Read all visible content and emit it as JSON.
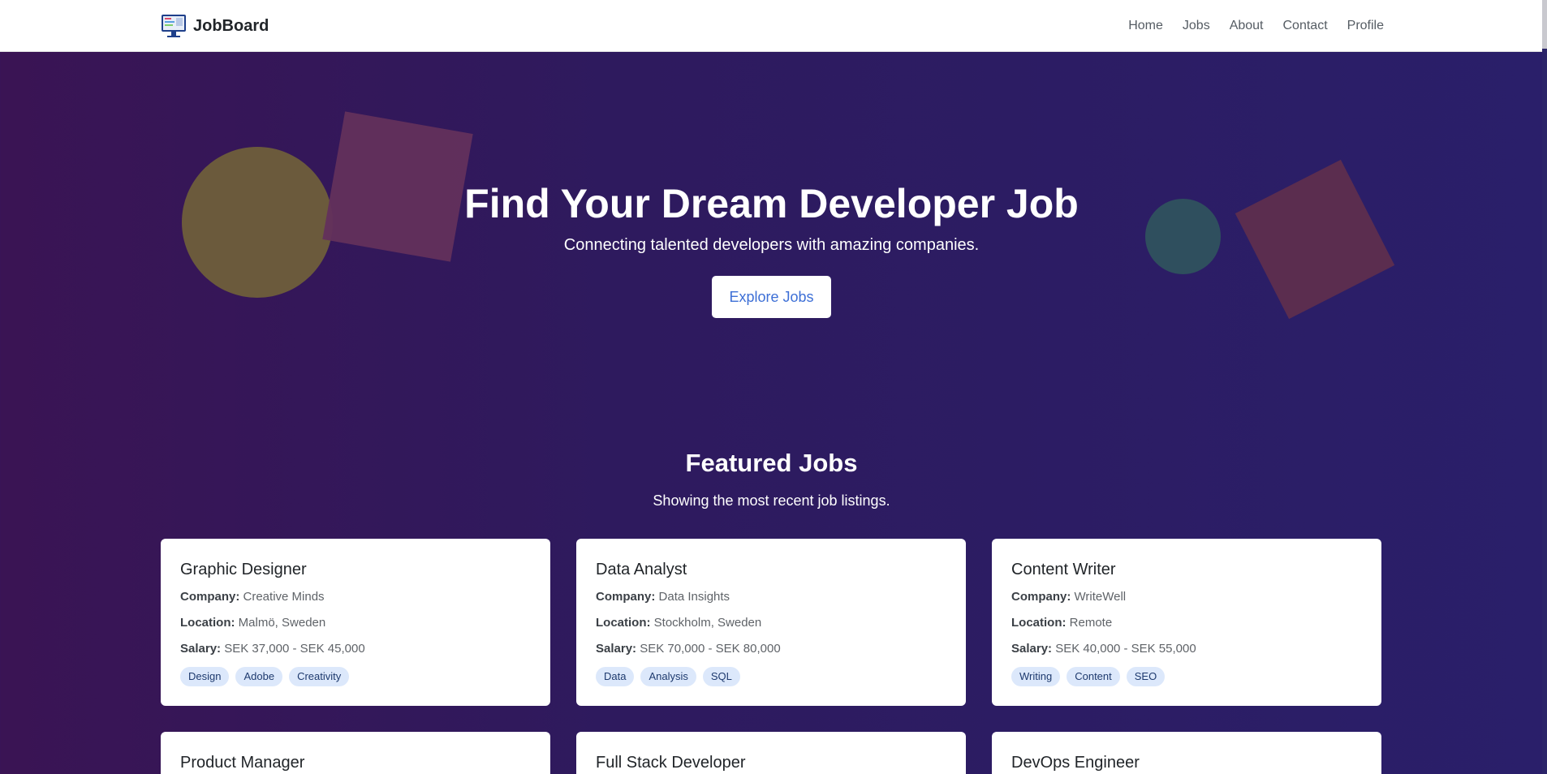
{
  "nav": {
    "brand": "JobBoard",
    "links": [
      "Home",
      "Jobs",
      "About",
      "Contact",
      "Profile"
    ]
  },
  "hero": {
    "title": "Find Your Dream Developer Job",
    "subtitle": "Connecting talented developers with amazing companies.",
    "cta": "Explore Jobs"
  },
  "featured": {
    "title": "Featured Jobs",
    "subtitle": "Showing the most recent job listings.",
    "labels": {
      "company": "Company:",
      "location": "Location:",
      "salary": "Salary:"
    },
    "jobs": [
      {
        "title": "Graphic Designer",
        "company": "Creative Minds",
        "location": "Malmö, Sweden",
        "salary": "SEK 37,000 - SEK 45,000",
        "tags": [
          "Design",
          "Adobe",
          "Creativity"
        ]
      },
      {
        "title": "Data Analyst",
        "company": "Data Insights",
        "location": "Stockholm, Sweden",
        "salary": "SEK 70,000 - SEK 80,000",
        "tags": [
          "Data",
          "Analysis",
          "SQL"
        ]
      },
      {
        "title": "Content Writer",
        "company": "WriteWell",
        "location": "Remote",
        "salary": "SEK 40,000 - SEK 55,000",
        "tags": [
          "Writing",
          "Content",
          "SEO"
        ]
      },
      {
        "title": "Product Manager"
      },
      {
        "title": "Full Stack Developer"
      },
      {
        "title": "DevOps Engineer"
      }
    ]
  },
  "colors": {
    "accent": "#3d6fd6",
    "tag_bg": "#dce8fb",
    "tag_text": "#1e3a6e",
    "bg_left": "#3a1454",
    "bg_right": "#2a1f6a"
  },
  "icons": {
    "brand": "monitor-icon"
  }
}
